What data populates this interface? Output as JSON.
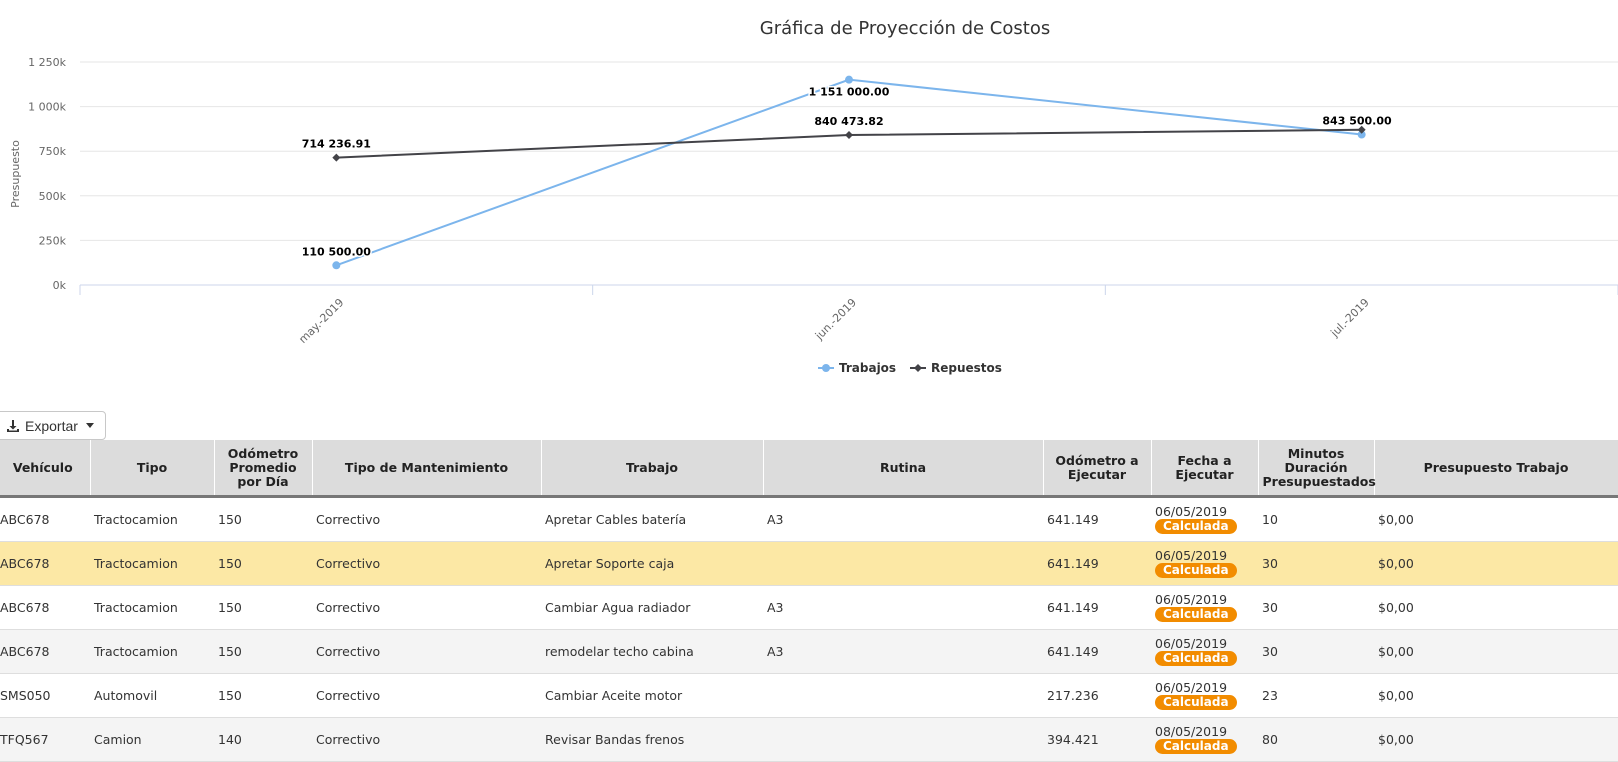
{
  "chart_data": {
    "type": "line",
    "title": "Gráfica de Proyección de Costos",
    "ylabel": "Presupuesto",
    "xlabel": "",
    "categories": [
      "may.-2019",
      "jun.-2019",
      "jul.-2019"
    ],
    "ylim": [
      0,
      1250000
    ],
    "yticks": [
      0,
      250000,
      500000,
      750000,
      1000000,
      1250000
    ],
    "ytick_labels": [
      "0k",
      "250k",
      "500k",
      "750k",
      "1 000k",
      "1 250k"
    ],
    "grid": true,
    "legend": "bottom-center",
    "series": [
      {
        "name": "Trabajos",
        "color": "#7cb5ec",
        "marker": "circle",
        "values": [
          110500,
          1151000,
          843500
        ],
        "labels": [
          "110 500.00",
          "1 151 000.00",
          "843 500.00"
        ]
      },
      {
        "name": "Repuestos",
        "color": "#434348",
        "marker": "diamond",
        "values": [
          714236.91,
          840473.82,
          870000
        ],
        "labels": [
          "714 236.91",
          "840 473.82",
          ""
        ]
      }
    ]
  },
  "toolbar": {
    "export_label": "Exportar"
  },
  "table": {
    "columns": [
      "Vehículo",
      "Tipo",
      "Odómetro Promedio por Día",
      "Tipo de Mantenimiento",
      "Trabajo",
      "Rutina",
      "Odómetro a Ejecutar",
      "Fecha a Ejecutar",
      "Minutos Duración Presupuestados",
      "Presupuesto Trabajo"
    ],
    "rows": [
      {
        "vehiculo": "ABC678",
        "tipo": "Tractocamion",
        "odometro_dia": "150",
        "mantenimiento": "Correctivo",
        "trabajo": "Apretar Cables batería",
        "rutina": "A3",
        "odometro_ejecutar": "641.149",
        "fecha": "06/05/2019",
        "estado": "Calculada",
        "minutos": "10",
        "presupuesto": "$0,00"
      },
      {
        "vehiculo": "ABC678",
        "tipo": "Tractocamion",
        "odometro_dia": "150",
        "mantenimiento": "Correctivo",
        "trabajo": "Apretar Soporte caja",
        "rutina": "",
        "odometro_ejecutar": "641.149",
        "fecha": "06/05/2019",
        "estado": "Calculada",
        "minutos": "30",
        "presupuesto": "$0,00",
        "highlight": true
      },
      {
        "vehiculo": "ABC678",
        "tipo": "Tractocamion",
        "odometro_dia": "150",
        "mantenimiento": "Correctivo",
        "trabajo": "Cambiar Agua radiador",
        "rutina": "A3",
        "odometro_ejecutar": "641.149",
        "fecha": "06/05/2019",
        "estado": "Calculada",
        "minutos": "30",
        "presupuesto": "$0,00"
      },
      {
        "vehiculo": "ABC678",
        "tipo": "Tractocamion",
        "odometro_dia": "150",
        "mantenimiento": "Correctivo",
        "trabajo": "remodelar techo cabina",
        "rutina": "A3",
        "odometro_ejecutar": "641.149",
        "fecha": "06/05/2019",
        "estado": "Calculada",
        "minutos": "30",
        "presupuesto": "$0,00"
      },
      {
        "vehiculo": "SMS050",
        "tipo": "Automovil",
        "odometro_dia": "150",
        "mantenimiento": "Correctivo",
        "trabajo": "Cambiar Aceite motor",
        "rutina": "",
        "odometro_ejecutar": "217.236",
        "fecha": "06/05/2019",
        "estado": "Calculada",
        "minutos": "23",
        "presupuesto": "$0,00"
      },
      {
        "vehiculo": "TFQ567",
        "tipo": "Camion",
        "odometro_dia": "140",
        "mantenimiento": "Correctivo",
        "trabajo": "Revisar Bandas frenos",
        "rutina": "",
        "odometro_ejecutar": "394.421",
        "fecha": "08/05/2019",
        "estado": "Calculada",
        "minutos": "80",
        "presupuesto": "$0,00"
      }
    ]
  }
}
